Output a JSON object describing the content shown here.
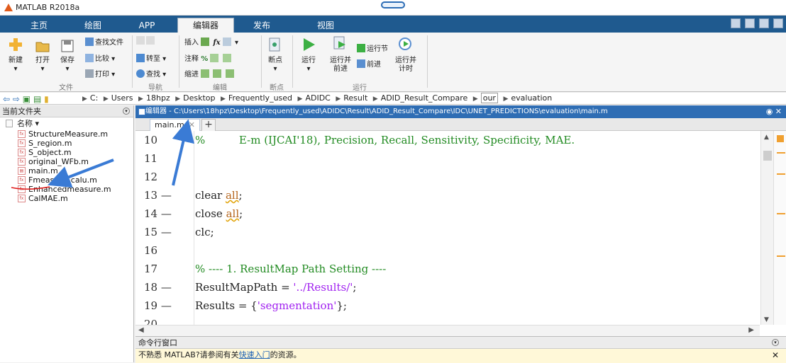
{
  "window": {
    "title": "MATLAB R2018a"
  },
  "tabs": [
    {
      "label": "主页"
    },
    {
      "label": "绘图"
    },
    {
      "label": "APP"
    },
    {
      "label": "编辑器",
      "active": true
    },
    {
      "label": "发布"
    },
    {
      "label": "视图"
    }
  ],
  "ribbon": {
    "file": {
      "group": "文件",
      "new": "新建",
      "open": "打开",
      "save": "保存",
      "find_files": "查找文件",
      "compare": "比较",
      "print": "打印"
    },
    "navigate": {
      "group": "导航",
      "goto": "转至",
      "find": "查找"
    },
    "edit": {
      "group": "编辑",
      "insert": "插入",
      "comment": "注释",
      "indent": "缩进",
      "fx": "fx"
    },
    "breakpoints": {
      "group": "断点",
      "breakpoints": "断点"
    },
    "run": {
      "group": "运行",
      "run": "运行",
      "run_advance": "运行并\n前进",
      "run_section": "运行节",
      "advance": "前进",
      "run_time": "运行并\n计时"
    }
  },
  "address": {
    "crumbs": [
      "C:",
      "Users",
      "18hpz",
      "Desktop",
      "Frequently_used",
      "ADIDC",
      "Result",
      "ADID_Result_Compare",
      "our",
      "evaluation"
    ]
  },
  "current_folder": {
    "title": "当前文件夹",
    "column": "名称",
    "files": [
      {
        "name": "StructureMeasure.m"
      },
      {
        "name": "S_region.m"
      },
      {
        "name": "S_object.m"
      },
      {
        "name": "original_WFb.m"
      },
      {
        "name": "main.m",
        "selected": true
      },
      {
        "name": "Fmeasure_calu.m"
      },
      {
        "name": "Enhancedmeasure.m"
      },
      {
        "name": "CalMAE.m"
      }
    ]
  },
  "editor": {
    "title": "编辑器 - C:\\Users\\18hpz\\Desktop\\Frequently_used\\ADIDC\\Result\\ADID_Result_Compare\\IDC\\UNET_PREDICTIONS\\evaluation\\main.m",
    "tab": "main.m",
    "lines": [
      {
        "no": "10",
        "dash": "",
        "text": "%          E-m (IJCAI'18), Precision, Recall, Sensitivity, Specificity, MAE."
      },
      {
        "no": "11",
        "dash": "",
        "text": ""
      },
      {
        "no": "12",
        "dash": "",
        "text": ""
      },
      {
        "no": "13",
        "dash": "—",
        "text": "clear all;"
      },
      {
        "no": "14",
        "dash": "—",
        "text": "close all;"
      },
      {
        "no": "15",
        "dash": "—",
        "text": "clc;"
      },
      {
        "no": "16",
        "dash": "",
        "text": ""
      },
      {
        "no": "17",
        "dash": "",
        "text": "% ---- 1. ResultMap Path Setting ----"
      },
      {
        "no": "18",
        "dash": "—",
        "text": "ResultMapPath = '../Results/';"
      },
      {
        "no": "19",
        "dash": "—",
        "text": "Results = {'segmentation'};"
      },
      {
        "no": "20",
        "dash": "",
        "text": ""
      }
    ]
  },
  "command_window": {
    "title": "命令行窗口",
    "notice_prefix": "不熟悉 MATLAB?请参阅有关",
    "notice_link": "快速入门",
    "notice_suffix": "的资源。"
  },
  "colors": {
    "tabbar": "#1f5a8f",
    "editor_title": "#2e6db4",
    "comment": "#228b22",
    "string": "#a020f0",
    "annotation": "#3a7bd5"
  }
}
